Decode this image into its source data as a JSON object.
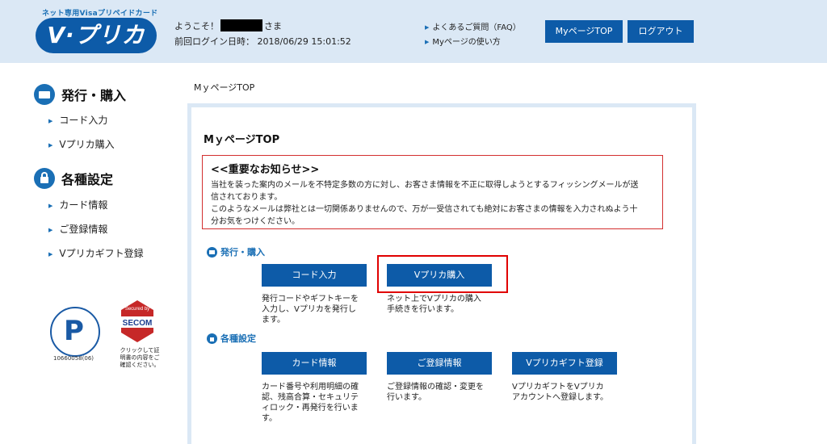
{
  "header": {
    "logo_subtitle": "ネット専用Visaプリペイドカード",
    "logo_text": "V·プリカ",
    "welcome_prefix": "ようこそ！",
    "welcome_suffix": "さま",
    "last_login": "前回ログイン日時： 2018/06/29 15:01:52",
    "links": [
      "よくあるご質問（FAQ）",
      "Myページの使い方"
    ],
    "mypage_button": "MyページTOP",
    "logout_button": "ログアウト"
  },
  "sidebar": {
    "sections": [
      {
        "title": "発行・購入",
        "icon": "card-icon",
        "items": [
          "コード入力",
          "Vプリカ購入"
        ]
      },
      {
        "title": "各種設定",
        "icon": "lock-icon",
        "items": [
          "カード情報",
          "ご登録情報",
          "Vプリカギフト登録"
        ]
      }
    ],
    "privacy_mark_number": "10660058(06)",
    "secom_badge_top": "Secured by",
    "secom_badge_name": "SECOM",
    "secom_note": "クリックして証明書の内容をご確認ください。"
  },
  "main": {
    "breadcrumb": "MｙページTOP",
    "title": "MｙページTOP",
    "notice": {
      "title": "<<重要なお知らせ>>",
      "lines": [
        "当社を装った案内のメールを不特定多数の方に対し、お客さま情報を不正に取得しようとするフィッシングメールが送",
        "信されております。",
        "このようなメールは弊社とは一切関係ありませんので、万が一受信されても絶対にお客さまの情報を入力されぬよう十",
        "分お気をつけください。"
      ]
    },
    "groups": [
      {
        "label": "発行・購入",
        "icon": "card-icon",
        "buttons": [
          {
            "label": "コード入力",
            "desc": [
              "発行コードやギフトキーを",
              "入力し、Vプリカを発行し",
              "ます。"
            ]
          },
          {
            "label": "Vプリカ購入",
            "desc": [
              "ネット上でVプリカの購入",
              "手続きを行います。"
            ]
          }
        ]
      },
      {
        "label": "各種設定",
        "icon": "lock-icon",
        "buttons": [
          {
            "label": "カード情報",
            "desc": [
              "カード番号や利用明細の確",
              "認、残高合算・セキュリテ",
              "ィロック・再発行を行いま",
              "す。"
            ]
          },
          {
            "label": "ご登録情報",
            "desc": [
              "ご登録情報の確認・変更を",
              "行います。"
            ]
          },
          {
            "label": "Vプリカギフト登録",
            "desc": [
              "VプリカギフトをVプリカ",
              "アカウントへ登録します。"
            ]
          }
        ]
      }
    ]
  },
  "colors": {
    "header_bg": "#dbe8f5",
    "button_blue": "#0d5ba8",
    "accent_blue": "#1a6fb5",
    "notice_border": "#d32f2f",
    "highlight_red": "#e00000"
  }
}
